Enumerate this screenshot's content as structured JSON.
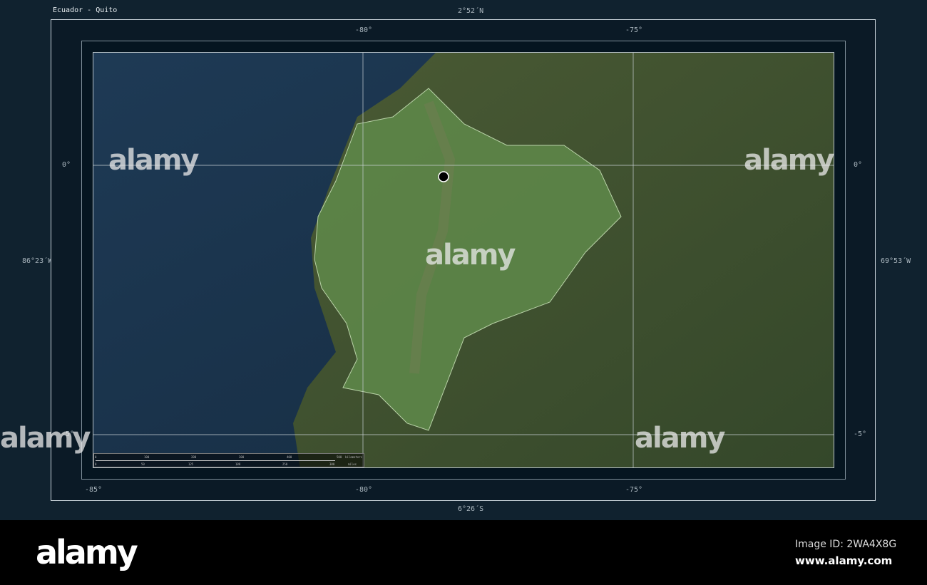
{
  "title": "Ecuador - Quito",
  "bounds": {
    "north": "2°52´N",
    "south": "6°26´S",
    "west": "86°23´W",
    "east": "69°53´W"
  },
  "lon_ticks": [
    "-85°",
    "-80°",
    "-75°"
  ],
  "lat_ticks": [
    "0°",
    "-5°"
  ],
  "capital": {
    "name": "Quito",
    "marker": "black-dot"
  },
  "scale_bar": {
    "km_ticks": [
      "0",
      "100",
      "200",
      "300",
      "400",
      "500"
    ],
    "km_unit": "kilometers",
    "mi_ticks": [
      "0",
      "50",
      "125",
      "188",
      "250",
      "300"
    ],
    "mi_unit": "miles"
  },
  "watermark": "alamy",
  "footer": {
    "logo": "alamy",
    "image_id": "Image ID: 2WA4X8G",
    "url": "www.alamy.com"
  },
  "colors": {
    "ocean": "#1b3550",
    "land": "#3b4f2c",
    "highlight": "#5f8a4a"
  }
}
